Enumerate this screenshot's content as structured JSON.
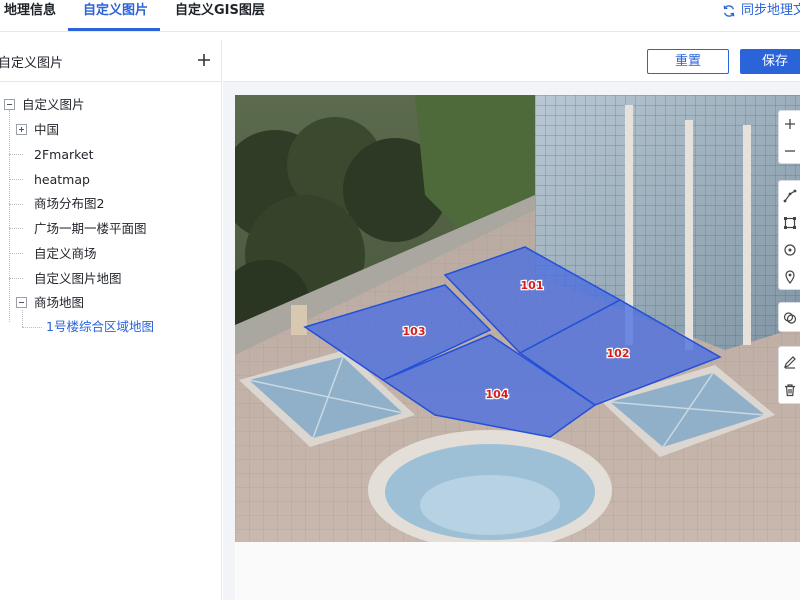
{
  "tabs": [
    {
      "label": "地理信息",
      "active": false
    },
    {
      "label": "自定义图片",
      "active": true
    },
    {
      "label": "自定义GIS图层",
      "active": false
    }
  ],
  "sync_label": "同步地理文",
  "left_panel": {
    "title": "自定义图片",
    "tree": {
      "root": "自定义图片",
      "items": [
        {
          "label": "中国"
        },
        {
          "label": "2Fmarket"
        },
        {
          "label": "heatmap"
        },
        {
          "label": "商场分布图2"
        },
        {
          "label": "广场一期一楼平面图"
        },
        {
          "label": "自定义商场"
        },
        {
          "label": "自定义图片地图"
        },
        {
          "label": "商场地图"
        },
        {
          "label": "1号楼综合区域地图",
          "selected": true
        }
      ]
    }
  },
  "toolbar": {
    "reset_label": "重置",
    "save_label": "保存"
  },
  "map": {
    "zones": [
      "101",
      "102",
      "103",
      "104"
    ],
    "zone_fill": "#4a6ee0",
    "zone_border": "#2450d8",
    "zone_label_color": "#d61d1d"
  },
  "map_tools": [
    "zoom-in-icon",
    "zoom-out-icon",
    "draw-line-icon",
    "draw-rectangle-icon",
    "draw-circle-icon",
    "draw-marker-icon",
    "overlap-icon",
    "edit-icon",
    "delete-icon"
  ],
  "colors": {
    "accent": "#2b63d9",
    "border": "#e6e8ee"
  }
}
